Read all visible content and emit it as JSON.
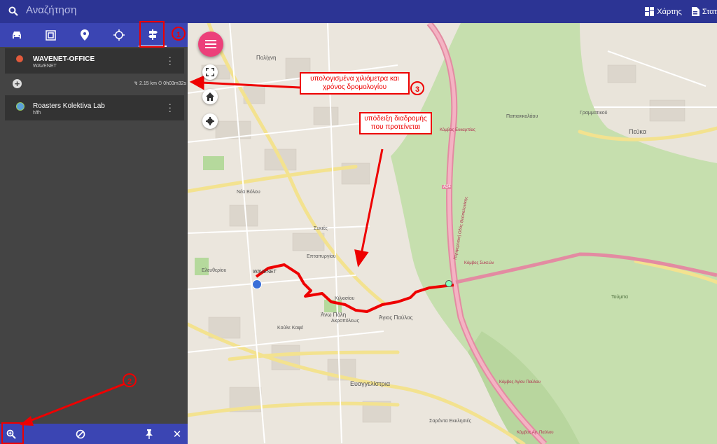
{
  "topbar": {
    "search_placeholder": "Αναζήτηση",
    "map_label": "Χάρτης",
    "stats_label": "Στατ"
  },
  "tabs": [
    "car-icon",
    "frame-icon",
    "pin-icon",
    "crosshair-icon",
    "directions-icon"
  ],
  "waypoints": [
    {
      "title": "WAVENET-OFFICE",
      "subtitle": "WAVENET"
    },
    {
      "title": "Roasters Kolektiva Lab",
      "subtitle": "hffh"
    }
  ],
  "route": {
    "distance": "2.15 km",
    "time": "0h03m32s"
  },
  "annotations": {
    "km_time": "υπολογισμένα χιλιόμετρα και χρόνος δρομολογίου",
    "route_hint": "υπόδειξη διαδρομής που προτείνεται",
    "n1": "1",
    "n2": "2",
    "n3": "3"
  },
  "map_labels": {
    "wavenet": "WAVENET",
    "polichni": "Πολίχνη",
    "ano_poli": "Άνω Πόλη",
    "agios_pavlos": "Άγιος Παύλος",
    "evangelistria": "Ευαγγελίστρια",
    "peuka": "Πεύκα",
    "toumba": "Τούμπα",
    "a24": "A24",
    "neos_kosmos": "Νέα Βόλου",
    "kombos_sykeon": "Κόμβος Συκεών",
    "kombos_efkarpias": "Κόμβος Ευκαρπίας",
    "kombos_agiou_pavlou": "Κόμβος Αγίου Παύλου",
    "kombos_ag_pavlou2": "Κόμβος Αγ. Παύλου",
    "perifereiaki": "Περιφερειακή Οδός Θεσσαλονίκης",
    "sykies": "Συκιές",
    "papanikolaou": "Παπανικολάου",
    "grammatikou": "Γραμματικού",
    "kilkisiou": "Κιλκισίου",
    "eleftheriou": "Ελευθερίου",
    "kakoi_kafes": "Κούλε Καφέ",
    "akropoleos": "Ακροπόλεως",
    "eptapyrgiou": "Επταπυργίου",
    "sarantaekklisies": "Σαράντα Εκκλησιές"
  }
}
